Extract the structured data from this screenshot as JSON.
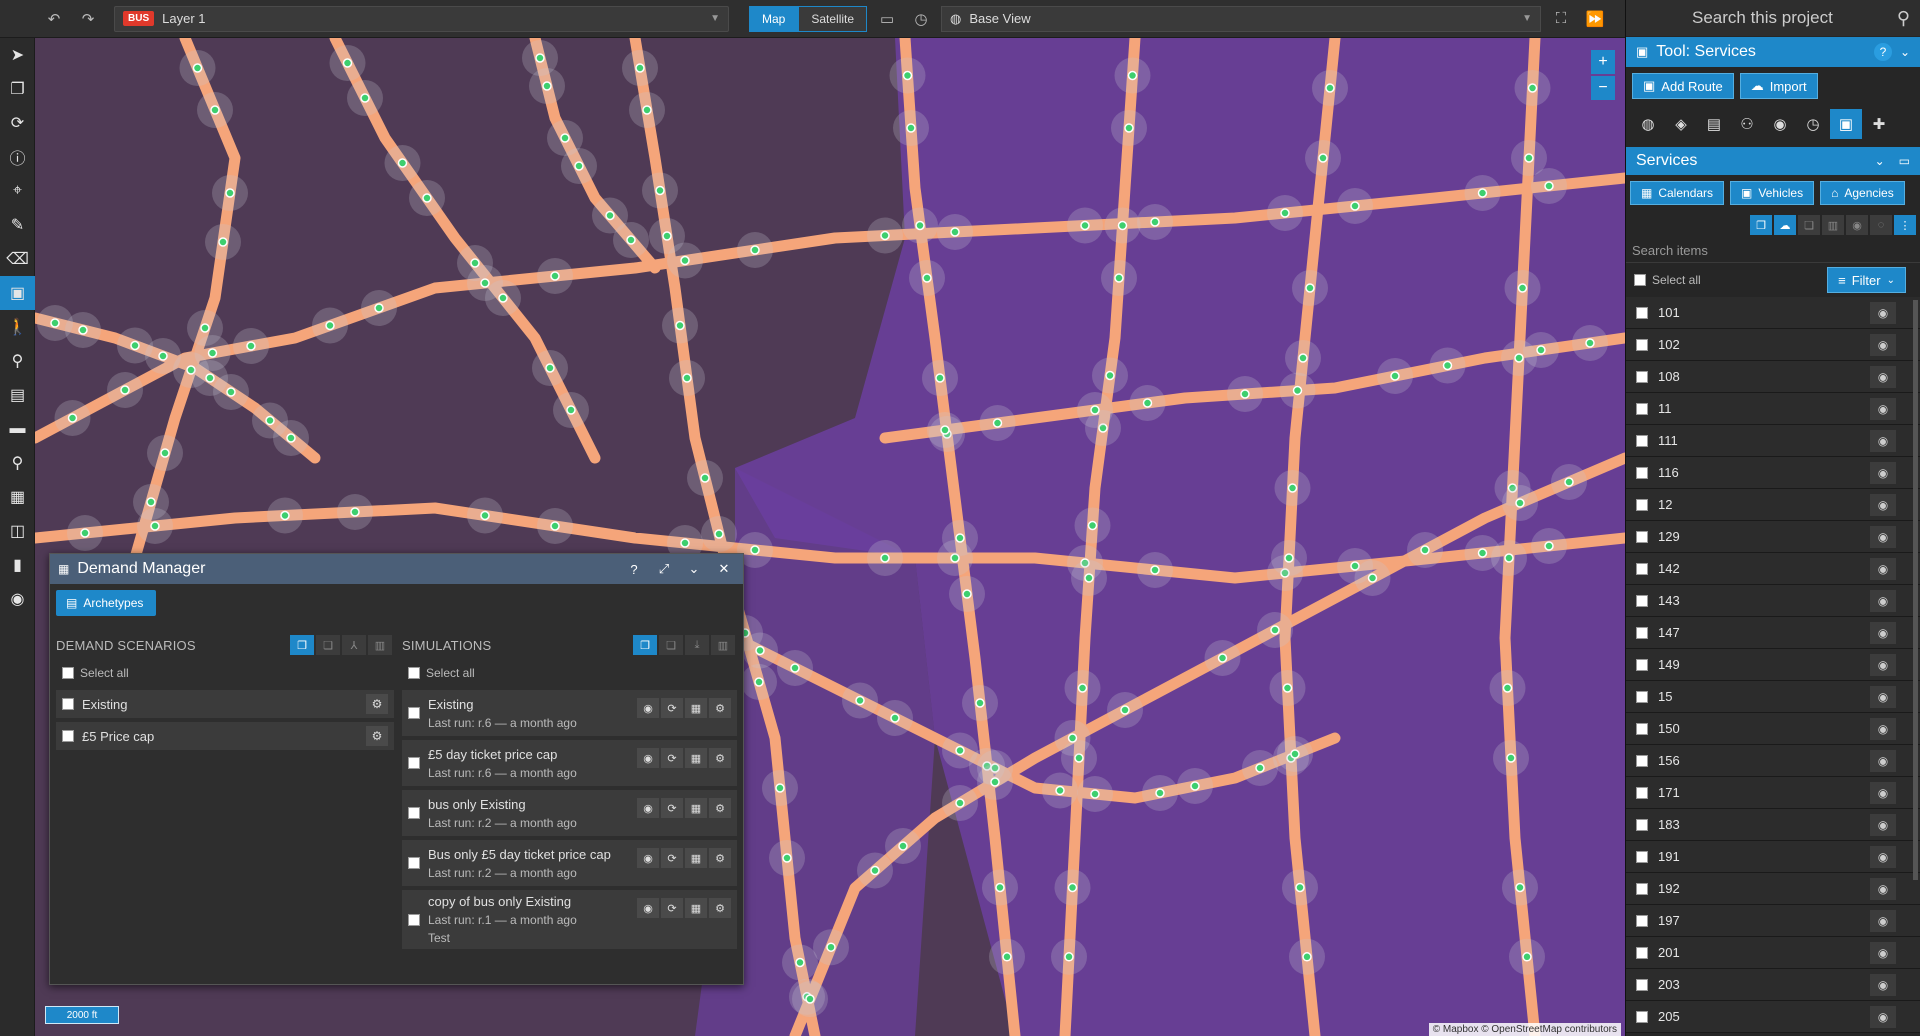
{
  "toolbar": {
    "layer_badge": "BUS",
    "layer_name": "Layer 1",
    "map_toggle": [
      "Map",
      "Satellite"
    ],
    "base_view": "Base View"
  },
  "left_tools": [
    "pointer-icon",
    "copy-layers-icon",
    "refresh-icon",
    "info-icon",
    "pin-icon",
    "pencil-icon",
    "eraser-icon",
    "bus-icon",
    "pedestrian-icon",
    "cyclist-icon",
    "comment-icon",
    "ruler-icon",
    "search-icon",
    "package-icon",
    "chip-icon",
    "chart-icon",
    "camera-icon"
  ],
  "map": {
    "scale": "2000 ft",
    "attribution": "© Mapbox © OpenStreetMap contributors",
    "zoom_in": "+",
    "zoom_out": "−"
  },
  "demand_manager": {
    "title": "Demand Manager",
    "tab": "Archetypes",
    "scenarios_title": "DEMAND SCENARIOS",
    "simulations_title": "SIMULATIONS",
    "select_all": "Select all",
    "scenarios": [
      {
        "label": "Existing"
      },
      {
        "label": "£5 Price cap"
      }
    ],
    "simulations": [
      {
        "title": "Existing",
        "sub": "Last run: r.6 — a month ago",
        "note": ""
      },
      {
        "title": "£5 day ticket price cap",
        "sub": "Last run: r.6 — a month ago",
        "note": ""
      },
      {
        "title": "bus only Existing",
        "sub": "Last run: r.2 — a month ago",
        "note": ""
      },
      {
        "title": "Bus only £5 day ticket price cap",
        "sub": "Last run: r.2 — a month ago",
        "note": ""
      },
      {
        "title": "copy of bus only Existing",
        "sub": "Last run: r.1 — a month ago",
        "note": "Test"
      }
    ]
  },
  "right_panel": {
    "search_placeholder": "Search this project",
    "tool_title": "Tool: Services",
    "add_route": "Add Route",
    "import": "Import",
    "section_title": "Services",
    "sub_buttons": [
      "Calendars",
      "Vehicles",
      "Agencies"
    ],
    "search_items": "Search items",
    "select_all": "Select all",
    "filter": "Filter",
    "services": [
      "101",
      "102",
      "108",
      "11",
      "111",
      "116",
      "12",
      "129",
      "142",
      "143",
      "147",
      "149",
      "15",
      "150",
      "156",
      "171",
      "183",
      "191",
      "192",
      "197",
      "201",
      "203",
      "205"
    ]
  },
  "colors": {
    "accent": "#1e88c9",
    "route": "#f5a57a",
    "stop": "#3ecf6e",
    "map_dark": "#4f3a55",
    "map_purple": "#6b3fa0"
  }
}
